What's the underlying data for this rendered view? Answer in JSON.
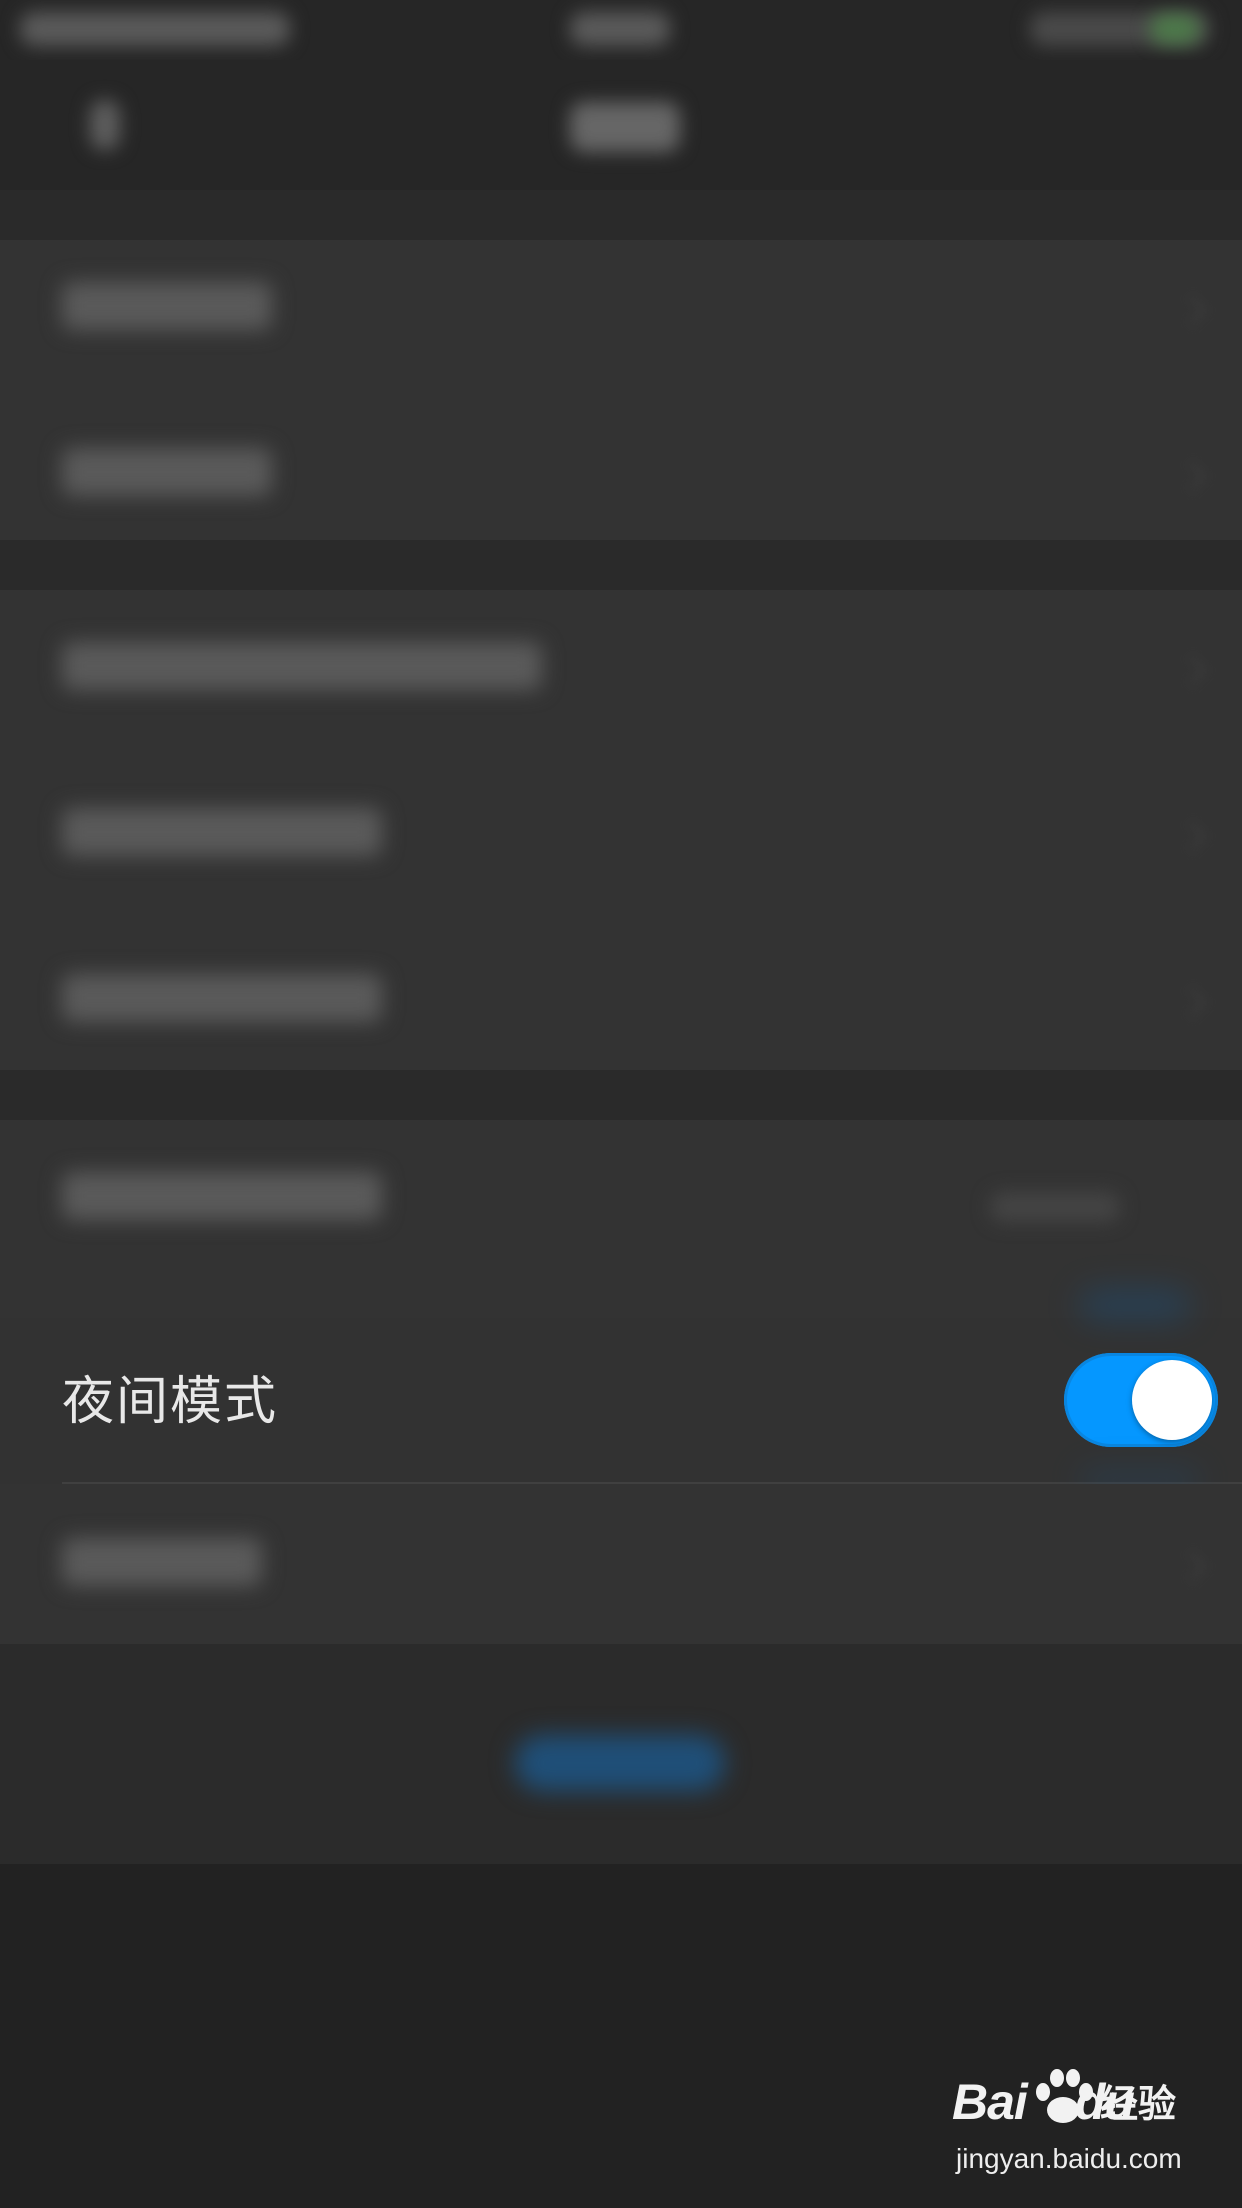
{
  "night_mode": {
    "label": "夜间模式",
    "enabled": true,
    "toggle_color": "#0597ff"
  },
  "watermark": {
    "logo_text": "Bai",
    "logo_text_2": "du",
    "logo_cn": "经验",
    "url": "jingyan.baidu.com"
  },
  "colors": {
    "background": "#222222",
    "row": "#333333",
    "text": "#e8e8e8"
  }
}
